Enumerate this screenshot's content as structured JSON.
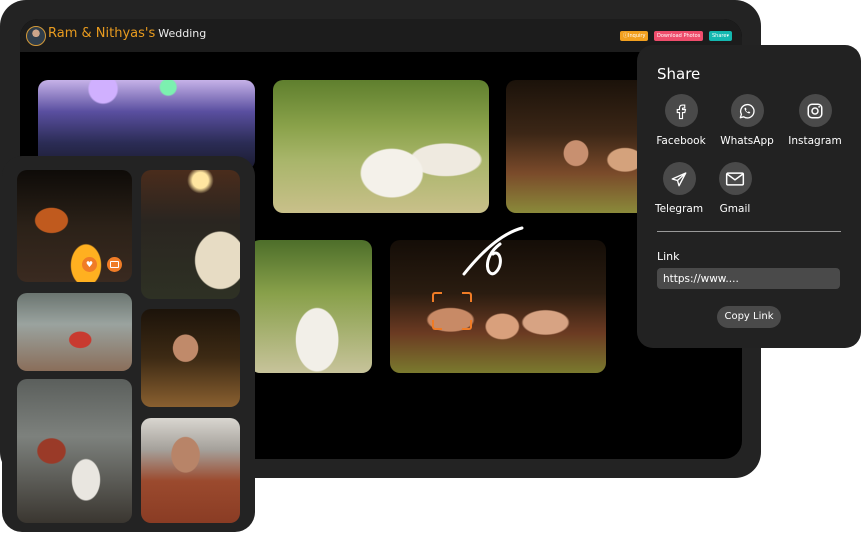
{
  "header": {
    "title_names": "Ram & Nithyas's",
    "title_suffix": "Wedding",
    "buttons": {
      "inquiry": "Inquiry",
      "download": "Download Photos",
      "share": "Share"
    }
  },
  "share_panel": {
    "title": "Share",
    "options": [
      {
        "label": "Facebook",
        "icon": "facebook-icon"
      },
      {
        "label": "WhatsApp",
        "icon": "whatsapp-icon"
      },
      {
        "label": "Instagram",
        "icon": "instagram-icon"
      },
      {
        "label": "Telegram",
        "icon": "telegram-icon"
      },
      {
        "label": "Gmail",
        "icon": "gmail-icon"
      }
    ],
    "link_label": "Link",
    "link_value": "https://www....",
    "copy_label": "Copy Link"
  },
  "colors": {
    "accent_orange": "#e89b1f",
    "inquiry": "#f2a01f",
    "download": "#ef4d6c",
    "share": "#14b8b0",
    "panel": "#222222"
  }
}
